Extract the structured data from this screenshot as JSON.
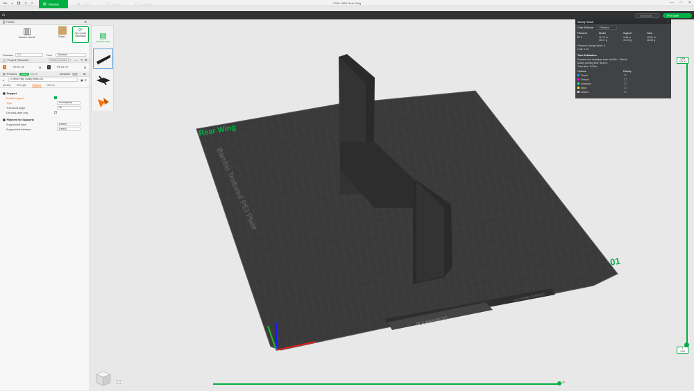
{
  "window": {
    "title": "1705 - BBS Rear Wing",
    "menu": [
      "File",
      "▾",
      "💾",
      "↶",
      "↷"
    ],
    "controls": [
      "—",
      "□",
      "✕"
    ]
  },
  "tabs": [
    {
      "label": "Prepare",
      "active": false
    },
    {
      "label": "Preview",
      "active": true
    },
    {
      "label": "Device",
      "active": false
    },
    {
      "label": "Project",
      "active": false
    },
    {
      "label": "Calibration",
      "active": false
    }
  ],
  "toolbar": {
    "slice_label": "Slice plate",
    "print_label": "Print plate"
  },
  "printer": {
    "section_title": "Printer",
    "name": "Bambu Lab A1",
    "plate": "Textur...",
    "sync_label": "Sync printer information",
    "nozzle_label": "Diameter",
    "nozzle_value": "0.4",
    "flow_label": "Flow",
    "flow_value": "Standard"
  },
  "filament": {
    "section_title": "Project Filaments",
    "tag": "Flushing volumes",
    "items": [
      {
        "index": "1",
        "name": "PETG HF",
        "color": "#ff6f00"
      },
      {
        "index": "2",
        "name": "PETG HF",
        "color": "#333333"
      }
    ]
  },
  "process": {
    "section_title": "Process",
    "global_label": "Global",
    "objects_label": "Objects",
    "advanced_label": "Advanced",
    "preset": "0.08mm High Quality @BBL A1",
    "subtabs": [
      "Quality",
      "Strength",
      "Support",
      "Others"
    ],
    "active_subtab": "Support",
    "group_support": "Support",
    "fields": [
      {
        "label": "Enable support",
        "value": "",
        "type": "checkbox",
        "checked": true,
        "highlight": true
      },
      {
        "label": "Type",
        "value": "normal(auto)",
        "type": "select",
        "highlight": true
      },
      {
        "label": "Threshold angle",
        "value": "15",
        "type": "spin"
      },
      {
        "label": "On build plate only",
        "value": "",
        "type": "checkbox",
        "checked": false
      }
    ],
    "group_filament": "Filament for Supports",
    "fields2": [
      {
        "label": "Support/raft base",
        "value": "Default"
      },
      {
        "label": "Support/raft interface",
        "value": "Default"
      }
    ]
  },
  "result": {
    "title": "Slicing Result",
    "color_scheme_label": "Color Scheme",
    "color_scheme_value": "Filament",
    "headers": [
      "Filament",
      "Model",
      "Support",
      "Total"
    ],
    "row": {
      "filament": "2",
      "model": "11.73 m\n35.17 g",
      "support": "3.48 m\n10.45 g",
      "total": "15.12 m\n46.08 g"
    },
    "change_times": "Filament change times: 0",
    "cost": "Cost: 1.16",
    "time_title": "Time Estimation",
    "prepare_time": "Prepare and timelapse time: 6m29s + 39m4s",
    "model_time": "Model printing time: 6h47m",
    "total_time": "Total time: 7h29m",
    "options_header": "Options",
    "display_header": "Display",
    "options": [
      {
        "label": "Travel",
        "color": "#00aaff"
      },
      {
        "label": "Retract",
        "color": "#ff00ff"
      },
      {
        "label": "Unretract",
        "color": "#00ffa0"
      },
      {
        "label": "Wipe",
        "color": "#ffff00"
      },
      {
        "label": "Seams",
        "color": "#d0d0d0"
      }
    ]
  },
  "plate": {
    "model_name": "Rear Wing",
    "plate_label": "Bambu Textured PEI Plate",
    "plate_number": "01",
    "material_text": "PLA/ABS/PETG",
    "surface_text": "TEXTURED SURFACE"
  },
  "layers": {
    "top": "1299",
    "top_height": "105.80",
    "bottom": "1",
    "bottom_height": "0.08"
  },
  "moves": {
    "value": "27"
  },
  "object_thumb_label": "All Plates Stats"
}
